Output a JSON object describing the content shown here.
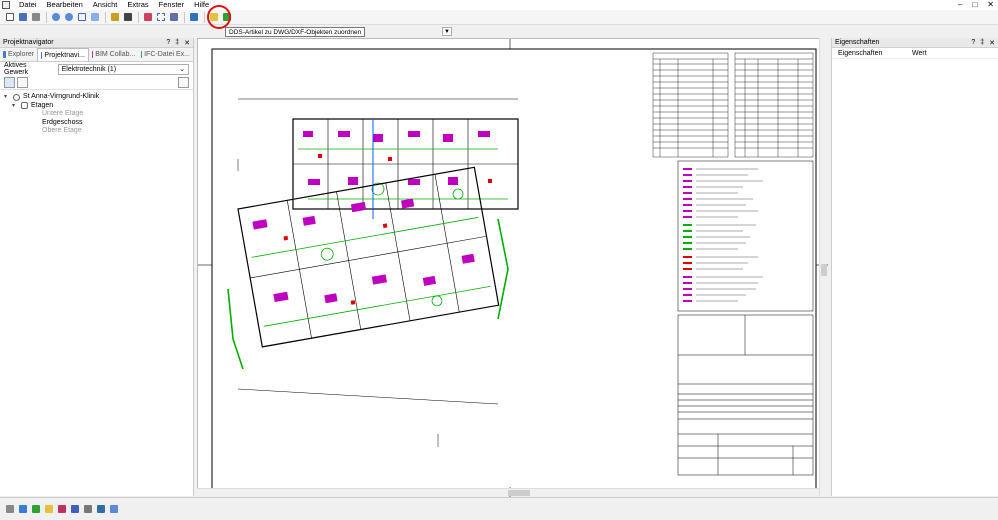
{
  "menu": {
    "items": [
      "Datei",
      "Bearbeiten",
      "Ansicht",
      "Extras",
      "Fenster",
      "Hilfe"
    ],
    "window_controls": [
      "–",
      "□",
      "✕"
    ]
  },
  "toolbar": {
    "tooltip": "DDS-Artikel zu DWG/DXF-Objekten zuordnen",
    "highlight_color": "#e01010"
  },
  "left_panel": {
    "title": "Projektnavigator",
    "controls": [
      "?",
      "‡",
      "✕"
    ],
    "tabs": [
      {
        "label": "Explorer",
        "color": "#3a7bd5",
        "active": false
      },
      {
        "label": "Projektnavi...",
        "color": "#3a7bd5",
        "active": true
      },
      {
        "label": "BIM Collab...",
        "color": "#c0308a",
        "active": false
      },
      {
        "label": "IFC-Datei Ex...",
        "color": "#2e9e5b",
        "active": false
      }
    ],
    "gewerk_label": "Aktives Gewerk",
    "gewerk_value": "Elektrotechnik (1)",
    "tree": {
      "root": "St Anna-Virngrund-Klinik",
      "etagen": "Etagen",
      "floors": [
        "Untere Etage",
        "Erdgeschoss",
        "Obere Etage"
      ]
    }
  },
  "right_panel": {
    "title": "Eigenschaften",
    "controls": [
      "?",
      "‡",
      "✕"
    ],
    "col_property": "Eigenschaften",
    "col_value": "Wert"
  },
  "colors": {
    "accent_magenta": "#c000c0",
    "plan_green": "#00b000",
    "plan_blue": "#0060ff",
    "plan_red": "#e00000"
  }
}
